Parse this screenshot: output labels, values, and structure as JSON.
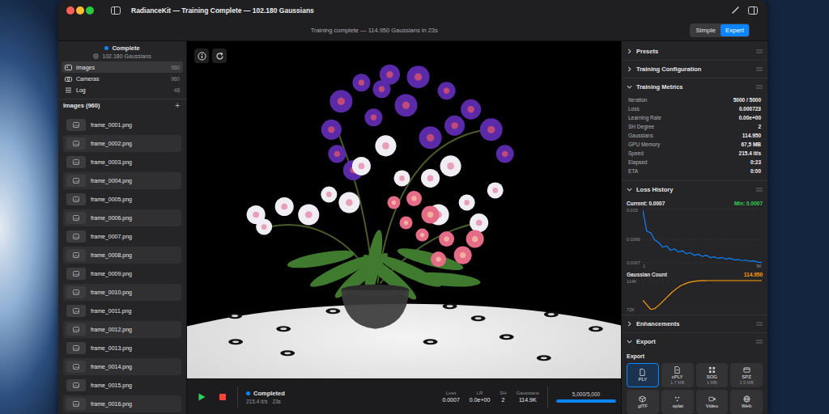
{
  "window": {
    "title": "RadianceKit — Training Complete — 102.180 Gaussians"
  },
  "toolbar": {
    "message": "Training complete — 114.950 Gaussians in 23s",
    "modes": [
      {
        "label": "Simple",
        "selected": false
      },
      {
        "label": "Expert",
        "selected": true
      }
    ]
  },
  "sidebar": {
    "status": "Complete",
    "gaussians": "102.180 Gaussians",
    "nav": [
      {
        "label": "Images",
        "count": "960",
        "selected": true
      },
      {
        "label": "Cameras",
        "count": "960",
        "selected": false
      },
      {
        "label": "Log",
        "count": "48",
        "selected": false
      }
    ],
    "list_title": "Images (960)",
    "add_button": "+",
    "images": [
      "frame_0001.png",
      "frame_0002.png",
      "frame_0003.png",
      "frame_0004.png",
      "frame_0005.png",
      "frame_0006.png",
      "frame_0007.png",
      "frame_0008.png",
      "frame_0009.png",
      "frame_0010.png",
      "frame_0011.png",
      "frame_0012.png",
      "frame_0013.png",
      "frame_0014.png",
      "frame_0015.png",
      "frame_0016.png"
    ]
  },
  "bottom_bar": {
    "status": "Completed",
    "speed": "215.4 it/s",
    "elapsed": "23s",
    "stats": [
      {
        "label": "Loss",
        "value": "0.0007"
      },
      {
        "label": "LR",
        "value": "0.0e+00"
      },
      {
        "label": "SH",
        "value": "2"
      },
      {
        "label": "Gaussians",
        "value": "114.9K"
      }
    ],
    "progress": {
      "label": "5,000/5,000",
      "level": 1
    }
  },
  "panel": {
    "sections": [
      {
        "title": "Presets",
        "expanded": false,
        "kind": "plain"
      },
      {
        "title": "Training Configuration",
        "expanded": false,
        "kind": "plain"
      },
      {
        "title": "Training Metrics",
        "expanded": true,
        "kind": "metrics",
        "rows": [
          {
            "label": "Iteration",
            "value": "5000 / 5000"
          },
          {
            "label": "Loss",
            "value": "0.000723"
          },
          {
            "label": "Learning Rate",
            "value": "0.00e+00"
          },
          {
            "label": "SH Degree",
            "value": "2"
          },
          {
            "label": "Gaussians",
            "value": "114.950"
          },
          {
            "label": "GPU Memory",
            "value": "67,5 MB"
          },
          {
            "label": "Speed",
            "value": "215.4 it/s"
          },
          {
            "label": "Elapsed",
            "value": "0:23"
          },
          {
            "label": "ETA",
            "value": "0:00"
          }
        ]
      },
      {
        "title": "Loss History",
        "expanded": true,
        "kind": "charts",
        "current": "Current: 0.0007",
        "min": "Min: 0.0007",
        "loss": {
          "y_ticks": [
            "0.015",
            "0.0069",
            "0.0007"
          ],
          "x_ticks": [
            "1",
            "5K"
          ],
          "values": [
            0.0148,
            0.0092,
            0.0087,
            0.0068,
            0.0061,
            0.0049,
            0.0052,
            0.0041,
            0.0044,
            0.0036,
            0.0039,
            0.0031,
            0.0034,
            0.0027,
            0.003,
            0.0024,
            0.0027,
            0.0021,
            0.0023,
            0.0019,
            0.0021,
            0.0017,
            0.0019,
            0.0015,
            0.0016,
            0.0013,
            0.0014,
            0.0011,
            0.0012,
            0.0009,
            0.0008
          ]
        },
        "count_label": "Gaussian Count",
        "count_value": "114.950",
        "count": {
          "y_ticks": [
            "114K",
            "72K"
          ],
          "values": [
            86000,
            79000,
            72000,
            74000,
            79000,
            85000,
            91000,
            97000,
            102000,
            106500,
            109500,
            111800,
            113300,
            114200,
            114700,
            114900,
            114950,
            114950,
            114950,
            114950,
            114950,
            114950,
            114950,
            114950,
            114950,
            114950,
            114950,
            114950,
            114950,
            114950
          ]
        }
      },
      {
        "title": "Enhancements",
        "expanded": false,
        "kind": "plain"
      },
      {
        "title": "Export",
        "expanded": true,
        "kind": "export",
        "subtitle": "Export",
        "formats": [
          {
            "label": "PLY",
            "selected": true
          },
          {
            "label": "cPLY",
            "size": "1.7 MB",
            "selected": false
          },
          {
            "label": "SOG",
            "size": "1 MB",
            "selected": false
          },
          {
            "label": "SPZ",
            "size": "2.5 MB",
            "selected": false
          },
          {
            "label": "glTF",
            "selected": false
          },
          {
            "label": ".splat",
            "selected": false
          },
          {
            "label": "Video",
            "selected": false
          },
          {
            "label": "Web",
            "selected": false
          }
        ]
      }
    ]
  }
}
